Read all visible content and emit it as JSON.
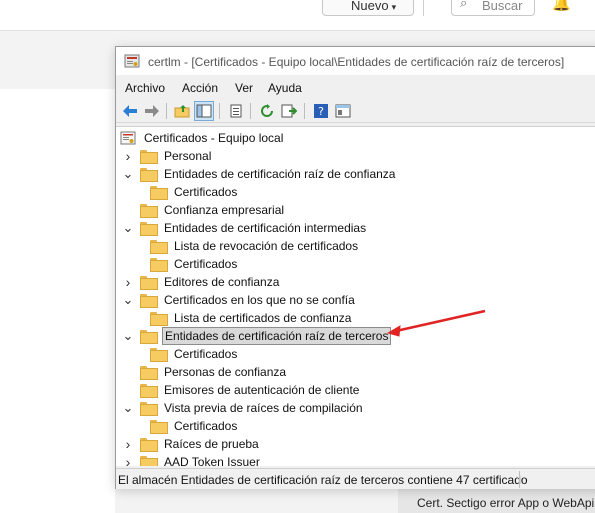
{
  "background": {
    "new_button_label": "Nuevo",
    "search_placeholder": "Buscar",
    "bottom_text": "Cert. Sectigo error App o WebApi"
  },
  "window": {
    "title": "certlm - [Certificados - Equipo local\\Entidades de certificación raíz de terceros]",
    "menu": [
      "Archivo",
      "Acción",
      "Ver",
      "Ayuda"
    ],
    "status": "El almacén Entidades de certificación raíz de terceros contiene 47 certificado"
  },
  "tree": {
    "root": "Certificados - Equipo local",
    "items": [
      {
        "label": "Personal",
        "expander": "collapsed",
        "level": 1
      },
      {
        "label": "Entidades de certificación raíz de confianza",
        "expander": "expanded",
        "level": 1
      },
      {
        "label": "Certificados",
        "expander": "none",
        "level": 2
      },
      {
        "label": "Confianza empresarial",
        "expander": "none",
        "level": 1
      },
      {
        "label": "Entidades de certificación intermedias",
        "expander": "expanded",
        "level": 1
      },
      {
        "label": "Lista de revocación de certificados",
        "expander": "none",
        "level": 2
      },
      {
        "label": "Certificados",
        "expander": "none",
        "level": 2
      },
      {
        "label": "Editores de confianza",
        "expander": "collapsed",
        "level": 1
      },
      {
        "label": "Certificados en los que no se confía",
        "expander": "expanded",
        "level": 1
      },
      {
        "label": "Lista de certificados de confianza",
        "expander": "none",
        "level": 2
      },
      {
        "label": "Entidades de certificación raíz de terceros",
        "expander": "expanded",
        "level": 1,
        "selected": true
      },
      {
        "label": "Certificados",
        "expander": "none",
        "level": 2
      },
      {
        "label": "Personas de confianza",
        "expander": "none",
        "level": 1
      },
      {
        "label": "Emisores de autenticación de cliente",
        "expander": "none",
        "level": 1
      },
      {
        "label": "Vista previa de raíces de compilación",
        "expander": "expanded",
        "level": 1
      },
      {
        "label": "Certificados",
        "expander": "none",
        "level": 2
      },
      {
        "label": "Raíces de prueba",
        "expander": "collapsed",
        "level": 1
      },
      {
        "label": "AAD Token Issuer",
        "expander": "collapsed",
        "level": 1
      }
    ]
  },
  "colors": {
    "annotation_arrow": "#e02424",
    "folder": "#f6cc62",
    "selection": "#d9d9d9"
  }
}
